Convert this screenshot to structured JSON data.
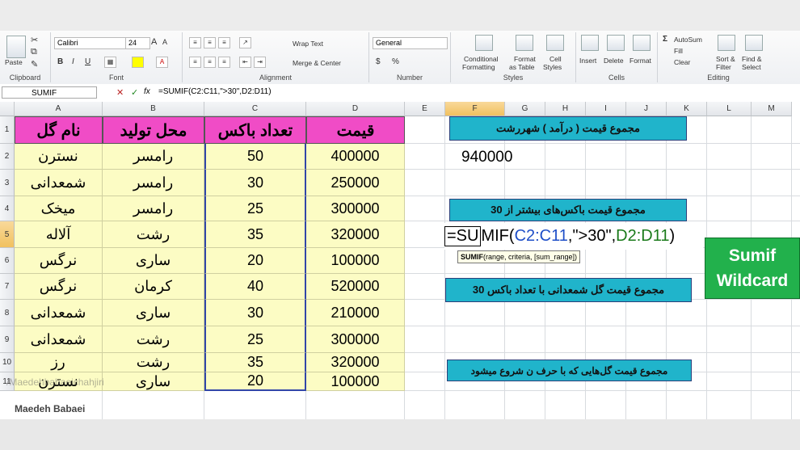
{
  "ribbon": {
    "clipboard": {
      "paste": "Paste",
      "label": "Clipboard"
    },
    "font": {
      "name": "Calibri",
      "size": "24",
      "label": "Font",
      "bold": "B",
      "italic": "I",
      "underline": "U",
      "grow": "A",
      "shrink": "A"
    },
    "alignment": {
      "wrap": "Wrap Text",
      "merge": "Merge & Center",
      "label": "Alignment"
    },
    "number": {
      "format": "General",
      "label": "Number",
      "currency": "$",
      "percent": "%"
    },
    "styles": {
      "conditional_1": "Conditional",
      "conditional_2": "Formatting",
      "table_1": "Format",
      "table_2": "as Table",
      "cell_1": "Cell",
      "cell_2": "Styles",
      "label": "Styles"
    },
    "cells": {
      "insert": "Insert",
      "delete": "Delete",
      "format": "Format",
      "label": "Cells"
    },
    "editing": {
      "autosum": "AutoSum",
      "fill": "Fill",
      "clear": "Clear",
      "sort_1": "Sort &",
      "sort_2": "Filter",
      "find_1": "Find &",
      "find_2": "Select",
      "label": "Editing"
    }
  },
  "formula_bar": {
    "name_box": "SUMIF",
    "fx": "fx",
    "formula": "=SUMIF(C2:C11,\">30\",D2:D11)",
    "cancel": "✕",
    "enter": "✓"
  },
  "columns": [
    "A",
    "B",
    "C",
    "D",
    "E",
    "F",
    "G",
    "H",
    "I",
    "J",
    "K",
    "L",
    "M"
  ],
  "rows": [
    "1",
    "2",
    "3",
    "4",
    "5",
    "6",
    "7",
    "8",
    "9",
    "10",
    "11"
  ],
  "headers": {
    "name": "نام گل",
    "place": "محل تولید",
    "count": "تعداد باکس",
    "price": "قیمت"
  },
  "table": [
    {
      "name": "نسترن",
      "place": "رامسر",
      "count": "50",
      "price": "400000"
    },
    {
      "name": "شمعدانی",
      "place": "رامسر",
      "count": "30",
      "price": "250000"
    },
    {
      "name": "میخک",
      "place": "رامسر",
      "count": "25",
      "price": "300000"
    },
    {
      "name": "آلاله",
      "place": "رشت",
      "count": "35",
      "price": "320000"
    },
    {
      "name": "نرگس",
      "place": "ساری",
      "count": "20",
      "price": "100000"
    },
    {
      "name": "نرگس",
      "place": "کرمان",
      "count": "40",
      "price": "520000"
    },
    {
      "name": "شمعدانی",
      "place": "ساری",
      "count": "30",
      "price": "210000"
    },
    {
      "name": "شمعدانی",
      "place": "رشت",
      "count": "25",
      "price": "300000"
    },
    {
      "name": "رز",
      "place": "رشت",
      "count": "35",
      "price": "320000"
    },
    {
      "name": "نسترن",
      "place": "ساری",
      "count": "20",
      "price": "100000"
    }
  ],
  "boxes": {
    "box1": "مجموع قیمت ( درآمد ) شهررشت",
    "result1": "940000",
    "box2": "مجموع قیمت  باکس‌های بیشتر از 30",
    "box3": "مجموع قیمت گل شمعدانی با تعداد باکس 30",
    "box4": "مجموع قیمت گل‌هایی که با حرف ن شروع میشود"
  },
  "edit_formula": {
    "prefix": "=SU",
    "fn": "MIF(",
    "range1": "C2:C11",
    "mid": ",\">30\",",
    "range2": "D2:D11",
    "suffix": ")"
  },
  "tooltip": {
    "fn": "SUMIF",
    "args": "(range, criteria, [sum_range])"
  },
  "green_box": {
    "line1": "Sumif",
    "line2": "Wildcard"
  },
  "watermark": "/Maedehbabaeichahjiri",
  "author": "Maedeh Babaei",
  "colors": {
    "header_pink": "#f04cc6",
    "cell_yellow": "#fcfcc4",
    "box_blue": "#20b4cb",
    "box_green": "#22b14c"
  }
}
